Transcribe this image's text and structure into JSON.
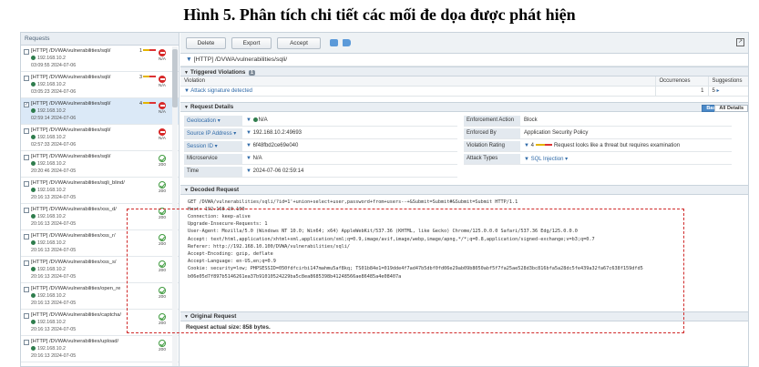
{
  "caption": "Hình 5. Phân tích chi tiết các mối đe dọa được phát hiện",
  "left": {
    "header": "Requests",
    "items": [
      {
        "url": "[HTTP] /DVWA/vulnerabilities/sqli/",
        "ip": "192.168.10.2",
        "time": "03:09:55 2024-07-06",
        "risk": "1",
        "status": "block",
        "status_text": "N/A",
        "checked": false,
        "selected": false
      },
      {
        "url": "[HTTP] /DVWA/vulnerabilities/sqli/",
        "ip": "192.168.10.2",
        "time": "03:05:23 2024-07-06",
        "risk": "3",
        "status": "block",
        "status_text": "N/A",
        "checked": false,
        "selected": false
      },
      {
        "url": "[HTTP] /DVWA/vulnerabilities/sqli/",
        "ip": "192.168.10.2",
        "time": "02:59:14 2024-07-06",
        "risk": "4",
        "status": "block",
        "status_text": "N/A",
        "checked": true,
        "selected": true
      },
      {
        "url": "[HTTP] /DVWA/vulnerabilities/sqli/",
        "ip": "192.168.10.2",
        "time": "02:57:33 2024-07-06",
        "risk": "",
        "status": "block",
        "status_text": "N/A",
        "checked": false,
        "selected": false
      },
      {
        "url": "[HTTP] /DVWA/vulnerabilities/sqli/",
        "ip": "192.168.10.2",
        "time": "20:20:46 2024-07-05",
        "risk": "",
        "status": "ok",
        "status_text": "200",
        "checked": false,
        "selected": false
      },
      {
        "url": "[HTTP] /DVWA/vulnerabilities/sqli_blind/",
        "ip": "192.168.10.2",
        "time": "20:16:13 2024-07-05",
        "risk": "",
        "status": "ok",
        "status_text": "200",
        "checked": false,
        "selected": false
      },
      {
        "url": "[HTTP] /DVWA/vulnerabilities/xss_d/",
        "ip": "192.168.10.2",
        "time": "20:16:13 2024-07-05",
        "risk": "",
        "status": "ok",
        "status_text": "200",
        "checked": false,
        "selected": false
      },
      {
        "url": "[HTTP] /DVWA/vulnerabilities/xss_r/",
        "ip": "192.168.10.2",
        "time": "20:16:13 2024-07-05",
        "risk": "",
        "status": "ok",
        "status_text": "200",
        "checked": false,
        "selected": false
      },
      {
        "url": "[HTTP] /DVWA/vulnerabilities/xss_s/",
        "ip": "192.168.10.2",
        "time": "20:16:13 2024-07-05",
        "risk": "",
        "status": "ok",
        "status_text": "200",
        "checked": false,
        "selected": false
      },
      {
        "url": "[HTTP] /DVWA/vulnerabilities/open_re",
        "ip": "192.168.10.2",
        "time": "20:16:13 2024-07-05",
        "risk": "",
        "status": "ok",
        "status_text": "200",
        "checked": false,
        "selected": false
      },
      {
        "url": "[HTTP] /DVWA/vulnerabilities/captcha/",
        "ip": "192.168.10.2",
        "time": "20:16:13 2024-07-05",
        "risk": "",
        "status": "ok",
        "status_text": "200",
        "checked": false,
        "selected": false
      },
      {
        "url": "[HTTP] /DVWA/vulnerabilities/upload/",
        "ip": "192.168.10.2",
        "time": "20:16:13 2024-07-05",
        "risk": "",
        "status": "ok",
        "status_text": "200",
        "checked": false,
        "selected": false
      }
    ]
  },
  "toolbar": {
    "delete": "Delete",
    "export": "Export",
    "accept": "Accept"
  },
  "url_line": "[HTTP] /DVWA/vulnerabilities/sqli/",
  "violations": {
    "header": "Triggered Violations",
    "count": "1",
    "col_violation": "Violation",
    "col_occurrences": "Occurrences",
    "col_suggestions": "Suggestions",
    "row_name": "Attack signature detected",
    "row_occurrences": "1",
    "row_suggestions": "5"
  },
  "details": {
    "header": "Request Details",
    "toggle_basic": "Basic",
    "toggle_all": "All Details",
    "rows": [
      {
        "label": "Geolocation",
        "value": "N/A"
      },
      {
        "label": "Source IP Address",
        "value": "192.168.10.2:49693"
      },
      {
        "label": "Session ID",
        "value": "6f48fbd2ce69e040"
      },
      {
        "label": "Microservice",
        "value": "N/A"
      },
      {
        "label": "Time",
        "value": "2024-07-06 02:59:14"
      }
    ],
    "right_rows": [
      {
        "label": "Enforcement Action",
        "value": "Block"
      },
      {
        "label": "Enforced By",
        "value": "Application Security Policy"
      },
      {
        "label": "Violation Rating",
        "rating": "4",
        "value": "Request looks like a threat but requires examination"
      },
      {
        "label": "Attack Types",
        "value": "SQL Injection"
      }
    ]
  },
  "decoded": {
    "header": "Decoded Request",
    "lines": [
      "GET /DVWA/vulnerabilities/sqli/?id=1'+union+select+user,password+from+users--+&Submit=Submit#&Submit=Submit HTTP/1.1",
      "Host: 192.168.10.100",
      "Connection: keep-alive",
      "Upgrade-Insecure-Requests: 1",
      "User-Agent: Mozilla/5.0 (Windows NT 10.0; Win64; x64) AppleWebKit/537.36 (KHTML, like Gecko) Chrome/125.0.0.0 Safari/537.36 Edg/125.0.0.0",
      "Accept: text/html,application/xhtml+xml,application/xml;q=0.9,image/avif,image/webp,image/apng,*/*;q=0.8,application/signed-exchange;v=b3;q=0.7",
      "Referer: http://192.168.10.100/DVWA/vulnerabilities/sqli/",
      "Accept-Encoding: gzip, deflate",
      "Accept-Language: en-US,en;q=0.9",
      "Cookie: security=low; PHPSESSID=050fdfcirbi147mahmu5af8kq; TS01b84e1=019dde4f7ad47b5dbf0fd06e29ab09b8050abf5f7fa25ae528d3bc816bfa5a28dc5fe439a32fa67c638f159dfd5",
      "b06e05d7f897b5146261ea37b91010524229ba5c8ea8685398b41248566ae86485a4e08407a"
    ]
  },
  "original": {
    "header": "Original Request",
    "size_label": "Request actual size: 858 bytes."
  }
}
